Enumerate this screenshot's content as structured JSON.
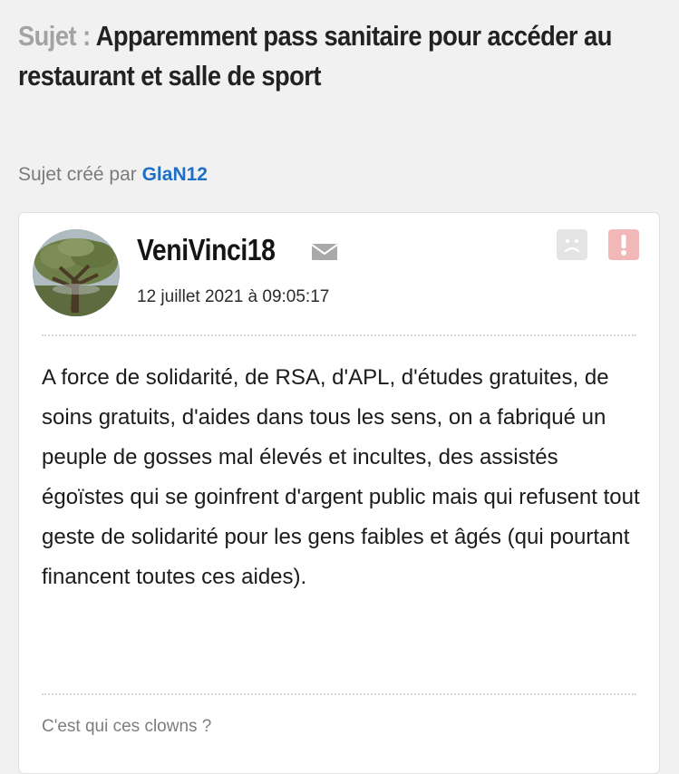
{
  "topic": {
    "prefix": "Sujet :",
    "title": "Apparemment pass sanitaire pour accéder au restaurant et salle de sport"
  },
  "author_line": {
    "label": "Sujet créé par",
    "author": "GlaN12"
  },
  "post": {
    "username": "VeniVinci18",
    "date": "12 juillet 2021 à 09:05:17",
    "avatar_icon": "tree-avatar",
    "mail_icon": "envelope-icon",
    "sad_icon": "sad-face-icon",
    "alert_icon": "exclamation-icon",
    "body": "A force de solidarité, de RSA, d'APL, d'études gratuites, de soins gratuits, d'aides dans tous les sens, on a fabriqué un peuple de gosses mal élevés et incultes, des assistés égoïstes qui se goinfrent d'argent public mais qui refusent tout geste de solidarité pour les gens faibles et âgés (qui pourtant financent toutes ces aides).",
    "signature": "C'est qui ces clowns ?"
  },
  "colors": {
    "background": "#f1f1f1",
    "link": "#1d6ec7",
    "alert": "#f2b8b8",
    "muted": "#a3a3a3"
  }
}
